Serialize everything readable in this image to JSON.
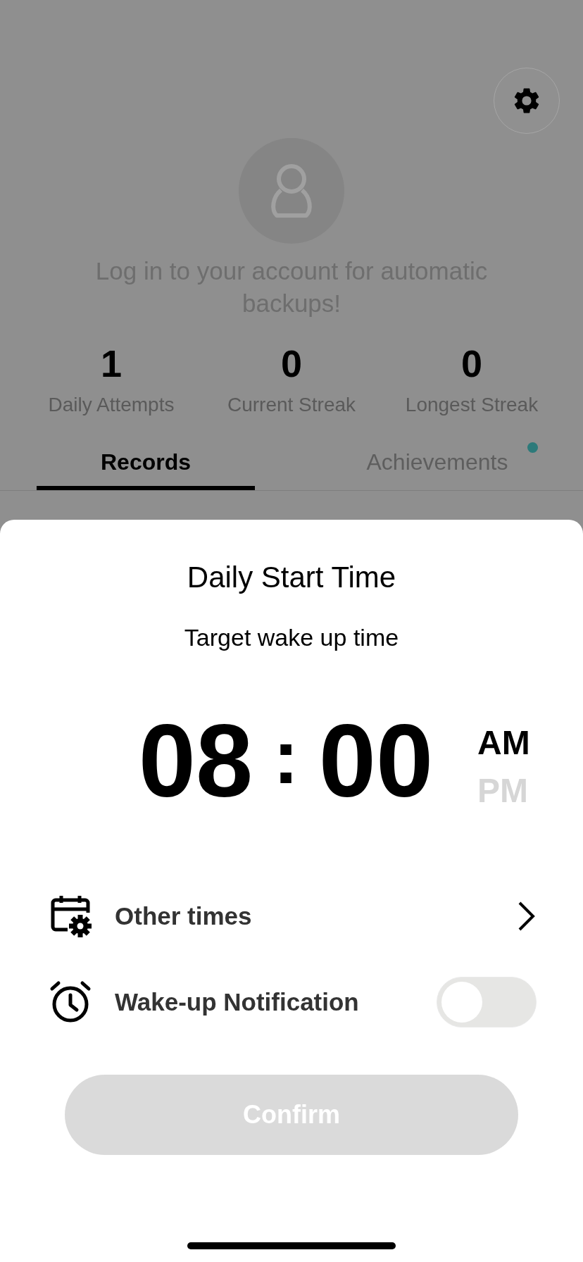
{
  "profile": {
    "login_prompt": "Log in to your account for automatic backups!"
  },
  "stats": [
    {
      "value": "1",
      "label": "Daily Attempts"
    },
    {
      "value": "0",
      "label": "Current Streak"
    },
    {
      "value": "0",
      "label": "Longest Streak"
    }
  ],
  "tabs": [
    {
      "label": "Records",
      "selected": true,
      "badge": false
    },
    {
      "label": "Achievements",
      "selected": false,
      "badge": true
    }
  ],
  "sheet": {
    "title": "Daily Start Time",
    "subtitle": "Target wake up time",
    "picker": {
      "hour": "08",
      "separator": ":",
      "minute": "00",
      "periods": [
        {
          "label": "AM",
          "selected": true
        },
        {
          "label": "PM",
          "selected": false
        }
      ]
    },
    "options": [
      {
        "kind": "link",
        "label": "Other times"
      },
      {
        "kind": "toggle",
        "label": "Wake-up Notification",
        "on": false
      }
    ],
    "confirm": {
      "label": "Confirm",
      "disabled": true
    }
  }
}
